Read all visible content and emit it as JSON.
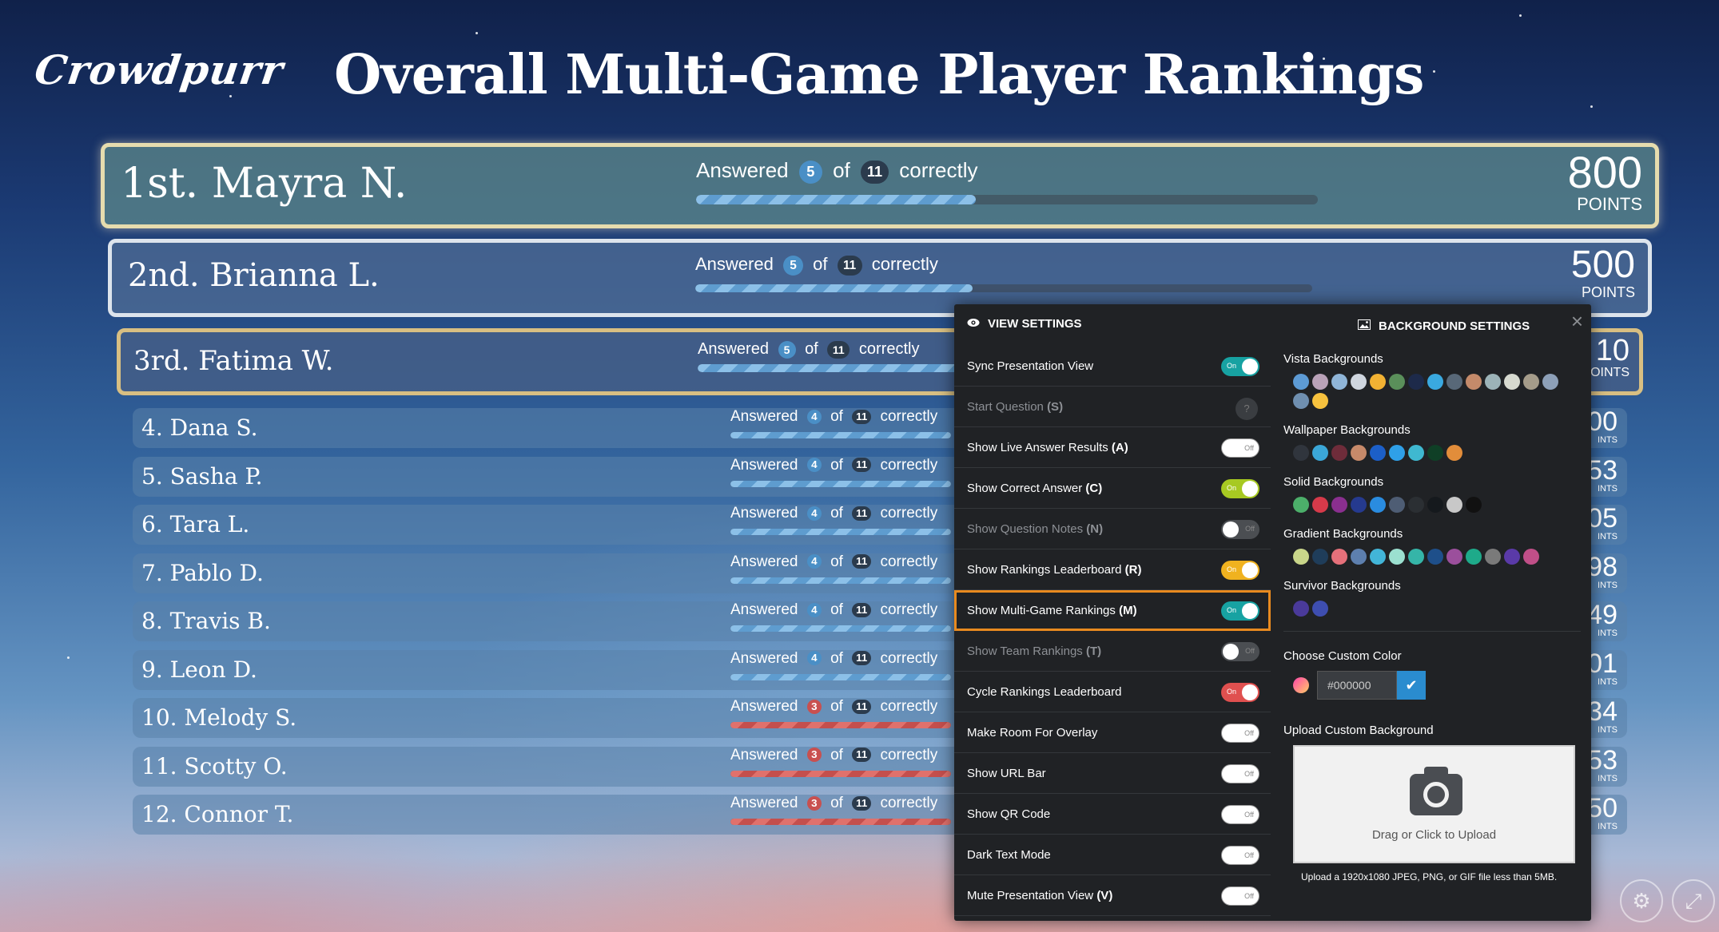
{
  "header": {
    "logo": "Crowdpurr",
    "title": "Overall Multi-Game Player Rankings"
  },
  "labels": {
    "answered": "Answered",
    "of": "of",
    "correctly": "correctly",
    "points": "POINTS"
  },
  "rankings": [
    {
      "name": "1st. Mayra N.",
      "correct": "5",
      "total": "11",
      "progress": 0.45,
      "points": "800",
      "status": "good"
    },
    {
      "name": "2nd. Brianna L.",
      "correct": "5",
      "total": "11",
      "progress": 0.45,
      "points": "500",
      "status": "good"
    },
    {
      "name": "3rd. Fatima W.",
      "correct": "5",
      "total": "11",
      "progress": 0.45,
      "points": "10",
      "points_label": "OINTS",
      "status": "good"
    },
    {
      "name": "4. Dana S.",
      "correct": "4",
      "total": "11",
      "progress": 0.36,
      "points": "00",
      "points_label": "INTS",
      "status": "good"
    },
    {
      "name": "5. Sasha P.",
      "correct": "4",
      "total": "11",
      "progress": 0.36,
      "points": "53",
      "points_label": "INTS",
      "status": "good"
    },
    {
      "name": "6. Tara L.",
      "correct": "4",
      "total": "11",
      "progress": 0.36,
      "points": "05",
      "points_label": "INTS",
      "status": "good"
    },
    {
      "name": "7. Pablo D.",
      "correct": "4",
      "total": "11",
      "progress": 0.36,
      "points": "98",
      "points_label": "INTS",
      "status": "good"
    },
    {
      "name": "8. Travis B.",
      "correct": "4",
      "total": "11",
      "progress": 0.36,
      "points": "49",
      "points_label": "INTS",
      "status": "good"
    },
    {
      "name": "9. Leon D.",
      "correct": "4",
      "total": "11",
      "progress": 0.36,
      "points": "01",
      "points_label": "INTS",
      "status": "good"
    },
    {
      "name": "10. Melody S.",
      "correct": "3",
      "total": "11",
      "progress": 0.27,
      "points": "34",
      "points_label": "INTS",
      "status": "bad"
    },
    {
      "name": "11. Scotty O.",
      "correct": "3",
      "total": "11",
      "progress": 0.27,
      "points": "53",
      "points_label": "INTS",
      "status": "bad"
    },
    {
      "name": "12. Connor T.",
      "correct": "3",
      "total": "11",
      "progress": 0.27,
      "points": "50",
      "points_label": "INTS",
      "status": "bad"
    }
  ],
  "panel": {
    "view_settings_title": "VIEW SETTINGS",
    "background_settings_title": "BACKGROUND SETTINGS",
    "toggle_on": "On",
    "toggle_off": "Off",
    "settings": [
      {
        "label": "Sync Presentation View",
        "key": "",
        "state": "on",
        "color": "#17a2a2",
        "disabled": false
      },
      {
        "label": "Start Question",
        "key": "(S)",
        "state": "help",
        "disabled": true
      },
      {
        "label": "Show Live Answer Results",
        "key": "(A)",
        "state": "off",
        "disabled": false
      },
      {
        "label": "Show Correct Answer",
        "key": "(C)",
        "state": "on",
        "color": "#a7c922",
        "disabled": false
      },
      {
        "label": "Show Question Notes",
        "key": "(N)",
        "state": "off",
        "disabled": true
      },
      {
        "label": "Show Rankings Leaderboard",
        "key": "(R)",
        "state": "on",
        "color": "#f0b21f",
        "disabled": false
      },
      {
        "label": "Show Multi-Game Rankings",
        "key": "(M)",
        "state": "on",
        "color": "#17a2a2",
        "disabled": false,
        "highlighted": true
      },
      {
        "label": "Show Team Rankings",
        "key": "(T)",
        "state": "off",
        "disabled": true
      },
      {
        "label": "Cycle Rankings Leaderboard",
        "key": "",
        "state": "on",
        "color": "#e0504f",
        "disabled": false
      },
      {
        "label": "Make Room For Overlay",
        "key": "",
        "state": "off",
        "disabled": false
      },
      {
        "label": "Show URL Bar",
        "key": "",
        "state": "off",
        "disabled": false
      },
      {
        "label": "Show QR Code",
        "key": "",
        "state": "off",
        "disabled": false
      },
      {
        "label": "Dark Text Mode",
        "key": "",
        "state": "off",
        "disabled": false
      },
      {
        "label": "Mute Presentation View",
        "key": "(V)",
        "state": "off",
        "disabled": false
      }
    ],
    "backgrounds": {
      "vista_label": "Vista Backgrounds",
      "vista": [
        "#5d9bd5",
        "#b9a2b8",
        "#8fb5d8",
        "#cfd6df",
        "#f2b233",
        "#5a8f5a",
        "#1d2a4a",
        "#3aa9e0",
        "#586878",
        "#c48a6a",
        "#9cb3b8",
        "#d7dad0",
        "#a59c8a",
        "#8da0b8",
        "#6f8fb0",
        "#f7c23e"
      ],
      "wallpaper_label": "Wallpaper Backgrounds",
      "wallpaper": [
        "#30353d",
        "#3ba7d8",
        "#6e2c3a",
        "#c78a6a",
        "#1c5fc8",
        "#2fa0e8",
        "#3fb8d0",
        "#0f3f26",
        "#e28d3a"
      ],
      "solid_label": "Solid Backgrounds",
      "solid": [
        "#4caf6a",
        "#d63a4a",
        "#8a2f8f",
        "#253a8f",
        "#2a8ce0",
        "#4e5d74",
        "#2b2f33",
        "#15191d",
        "#c8c8c8",
        "#111111"
      ],
      "gradient_label": "Gradient Backgrounds",
      "gradient": [
        "#c9d68a",
        "#1f3d5a",
        "#e5707a",
        "#5d7fae",
        "#42b5d8",
        "#9be0d0",
        "#35b5a8",
        "#1e4f8a",
        "#9b4f9c",
        "#1eaa8a",
        "#7a7a7a",
        "#5a3aa8",
        "#c04f88"
      ],
      "survivor_label": "Survivor Backgrounds",
      "survivor": [
        "#4a3a9a",
        "#3e4eb0"
      ],
      "custom_color_label": "Choose Custom Color",
      "custom_color_value": "#000000",
      "upload_label": "Upload Custom Background",
      "upload_text": "Drag or Click to Upload",
      "upload_note": "Upload a 1920x1080 JPEG, PNG, or GIF file less than 5MB."
    }
  }
}
